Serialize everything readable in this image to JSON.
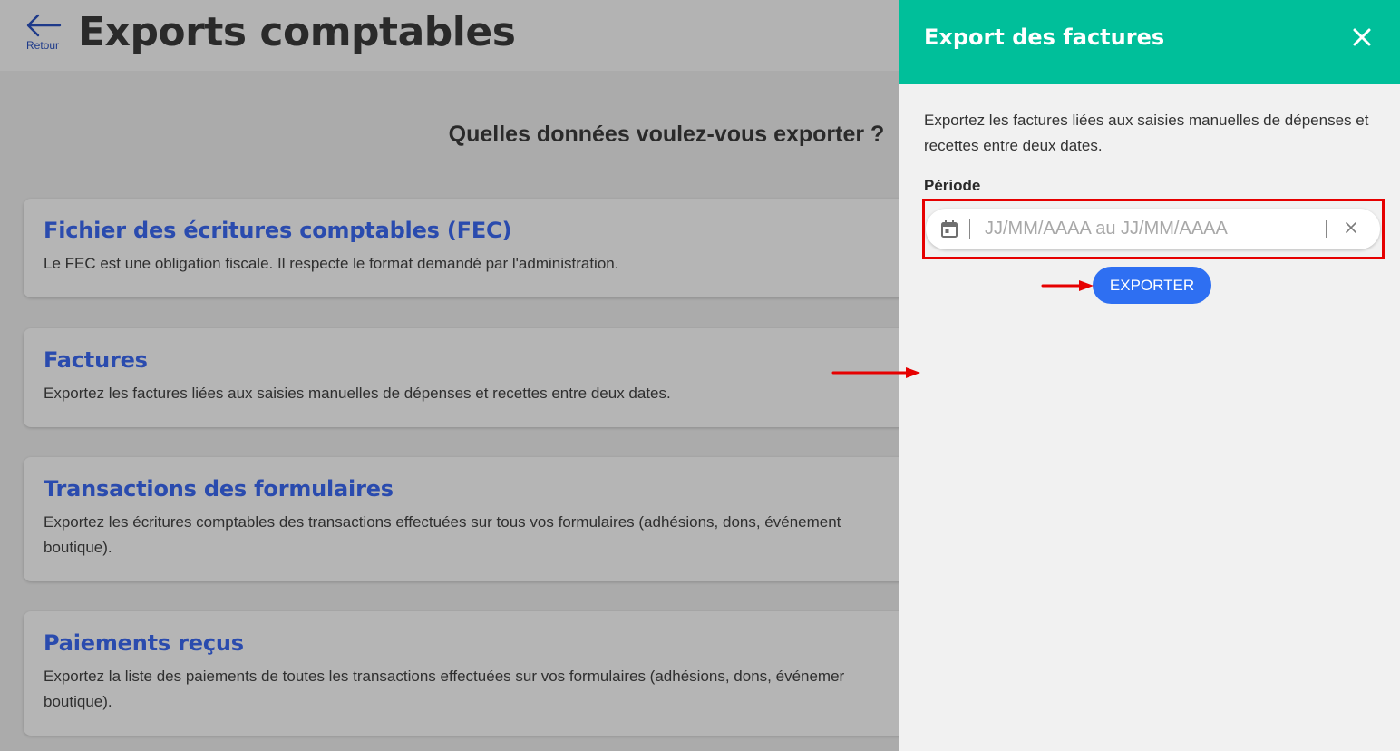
{
  "header": {
    "back_label": "Retour",
    "title": "Exports comptables"
  },
  "main": {
    "question": "Quelles données voulez-vous exporter ?",
    "cards": [
      {
        "title": "Fichier des écritures comptables (FEC)",
        "description_lines": [
          "Le FEC est une obligation fiscale. Il respecte le format demandé par l'administration."
        ]
      },
      {
        "title": "Factures",
        "description_lines": [
          "Exportez les factures liées aux saisies manuelles de dépenses et recettes entre deux dates."
        ]
      },
      {
        "title": "Transactions des formulaires",
        "description_lines": [
          "Exportez les écritures comptables des transactions effectuées sur tous vos formulaires (adhésions, dons, événement",
          "boutique)."
        ]
      },
      {
        "title": "Paiements reçus",
        "description_lines": [
          "Exportez la liste des paiements de toutes les transactions effectuées sur vos formulaires (adhésions, dons, événemer",
          "boutique)."
        ]
      }
    ]
  },
  "panel": {
    "title": "Export des factures",
    "description": "Exportez les factures liées aux saisies manuelles de dépenses et recettes entre deux dates.",
    "field_label": "Période",
    "date_placeholder": "JJ/MM/AAAA au JJ/MM/AAAA",
    "export_label": "EXPORTER"
  },
  "colors": {
    "panel_header": "#00bf9a",
    "export_button": "#2e6ff2",
    "card_title": "#2a4bae",
    "annotation_red": "#e60000"
  },
  "icons": [
    "arrow-left-icon",
    "close-icon",
    "calendar-icon",
    "clear-icon"
  ]
}
